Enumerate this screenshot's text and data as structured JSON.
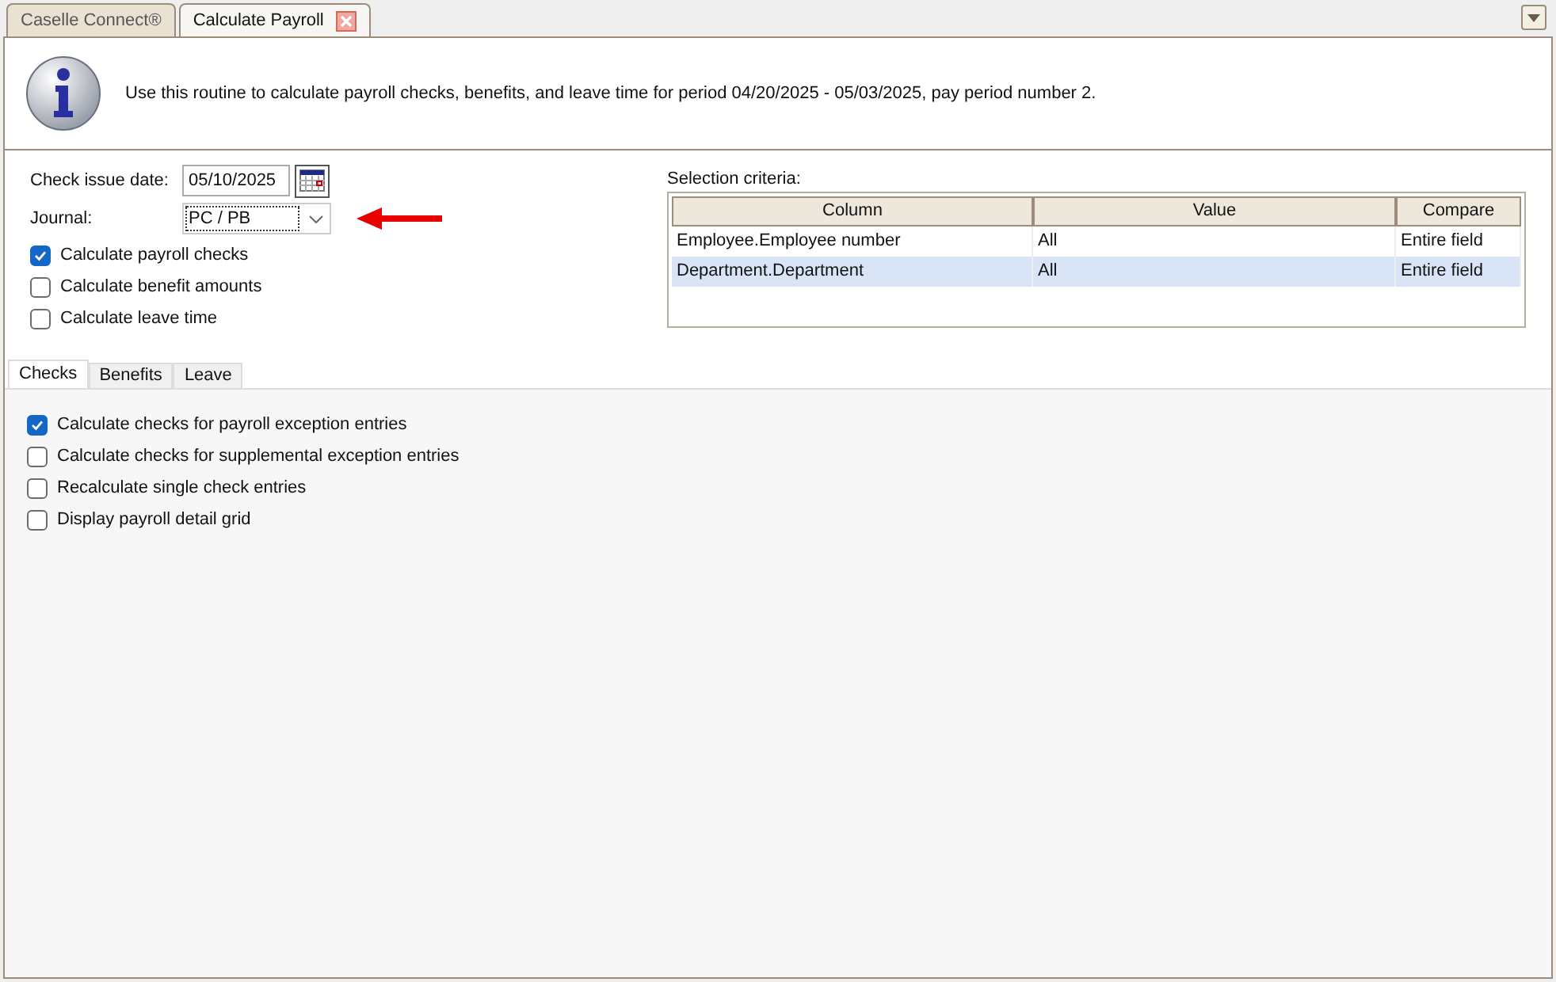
{
  "doc_tabs": [
    {
      "label": "Caselle Connect®",
      "selected": false,
      "closable": false
    },
    {
      "label": "Calculate Payroll",
      "selected": true,
      "closable": true
    }
  ],
  "header": {
    "message": "Use this routine to calculate payroll checks, benefits, and leave time for period 04/20/2025 - 05/03/2025, pay period number 2."
  },
  "check_issue_date": {
    "label": "Check issue date:",
    "value": "05/10/2025"
  },
  "journal": {
    "label": "Journal:",
    "value": "PC / PB"
  },
  "options": [
    {
      "label": "Calculate payroll checks",
      "checked": true
    },
    {
      "label": "Calculate benefit amounts",
      "checked": false
    },
    {
      "label": "Calculate leave time",
      "checked": false
    }
  ],
  "selection_criteria": {
    "label": "Selection criteria:",
    "columns": [
      "Column",
      "Value",
      "Compare"
    ],
    "rows": [
      {
        "cells": [
          "Employee.Employee number",
          "All",
          "Entire field"
        ],
        "selected": false
      },
      {
        "cells": [
          "Department.Department",
          "All",
          "Entire field"
        ],
        "selected": true
      }
    ]
  },
  "tabs": [
    {
      "label": "Checks",
      "selected": true
    },
    {
      "label": "Benefits",
      "selected": false
    },
    {
      "label": "Leave",
      "selected": false
    }
  ],
  "check_options": [
    {
      "label": "Calculate checks for payroll exception entries",
      "checked": true
    },
    {
      "label": "Calculate checks for supplemental exception entries",
      "checked": false
    },
    {
      "label": "Recalculate single check entries",
      "checked": false
    },
    {
      "label": "Display payroll detail grid",
      "checked": false
    }
  ]
}
